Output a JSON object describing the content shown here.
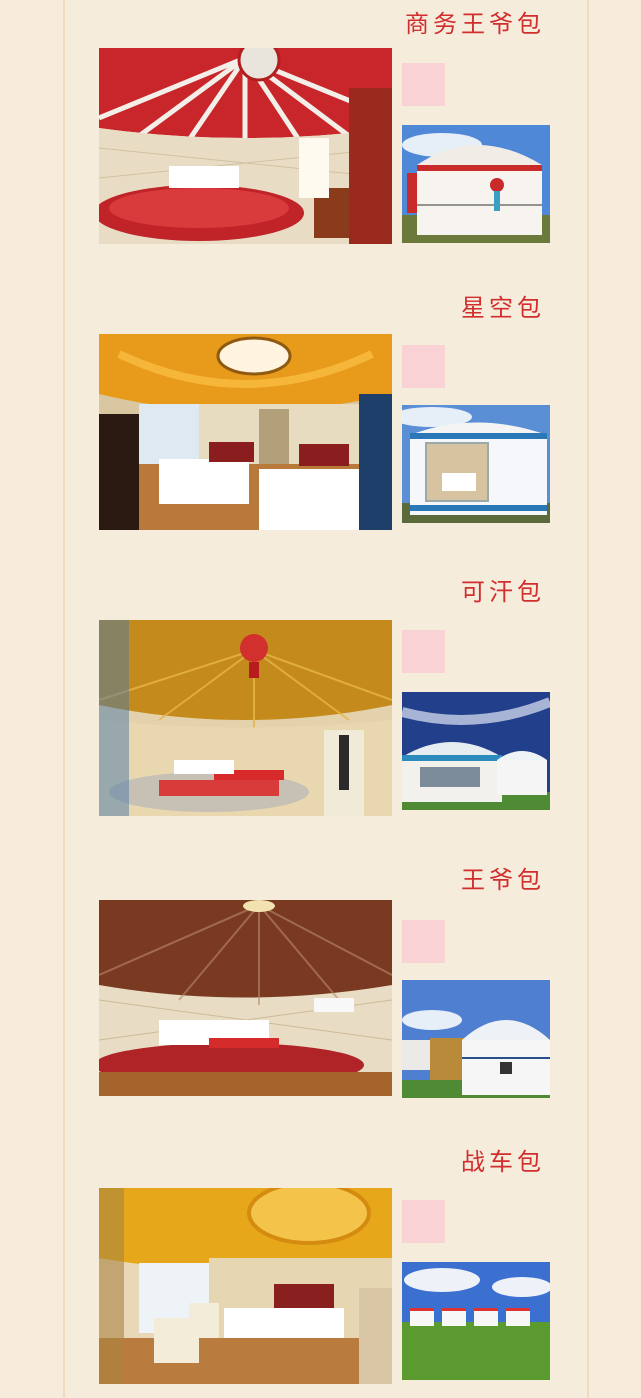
{
  "sections": [
    {
      "title": "商务王爷包",
      "photo": "yurt-interior-red-ceiling",
      "thumb": "yurt-exterior-white-red"
    },
    {
      "title": "星空包",
      "photo": "yurt-interior-orange-ceiling",
      "thumb": "yurt-exterior-glass-window"
    },
    {
      "title": "可汗包",
      "photo": "yurt-interior-golden-ceiling",
      "thumb": "yurt-exterior-blue-sky"
    },
    {
      "title": "王爷包",
      "photo": "yurt-interior-brown-ceiling",
      "thumb": "yurt-exterior-village"
    },
    {
      "title": "战车包",
      "photo": "yurt-interior-yellow-ceiling",
      "thumb": "yurt-exterior-grassland"
    }
  ],
  "colors": {
    "background": "#f7ecdb",
    "title_red": "#d12e2e",
    "tile_pink": "#f9d2d6"
  }
}
